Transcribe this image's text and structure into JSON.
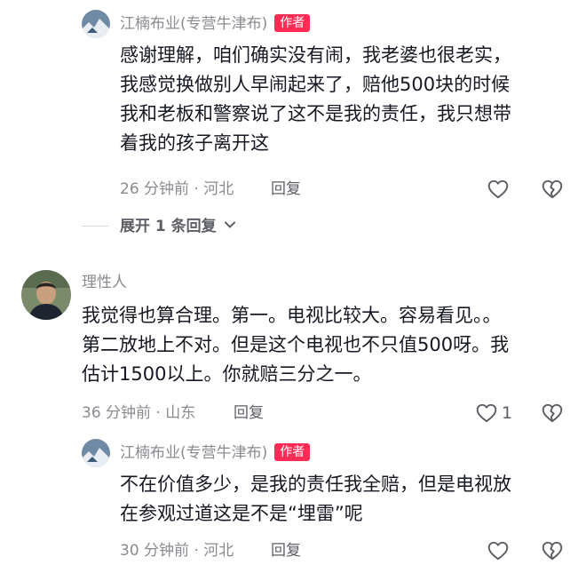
{
  "comments": [
    {
      "username": "江楠布业(专营牛津布)",
      "badge": "作者",
      "lines": [
        "感谢理解，咱们确实没有闹，我老婆也很老实，",
        "我感觉换做别人早闹起来了，赔他500块的时候",
        "我和老板和警察说了这不是我的责任，我只想带",
        "着我的孩子离开这"
      ],
      "meta": "26 分钟前 · 河北",
      "reply_label": "回复",
      "like_count": ""
    },
    {
      "username": "理性人",
      "lines": [
        "我觉得也算合理。第一。电视比较大。容易看见。。",
        "第二放地上不对。但是这个电视也不只值500呀。我",
        "估计1500以上。你就赔三分之一。"
      ],
      "meta": "36 分钟前 · 山东",
      "reply_label": "回复",
      "like_count": "1"
    },
    {
      "username": "江楠布业(专营牛津布)",
      "badge": "作者",
      "lines": [
        "不在价值多少，是我的责任我全赔，但是电视放",
        "在参观过道这是不是“埋雷”呢"
      ],
      "meta": "30 分钟前 · 河北",
      "reply_label": "回复",
      "like_count": ""
    }
  ],
  "expand_replies_label": "展开 1 条回复",
  "icons": {
    "like": "heart-outline-icon",
    "dislike": "broken-heart-icon",
    "expand": "chevron-down-icon"
  },
  "colors": {
    "author_badge": "#fe2c55",
    "meta_gray": "#8a8b91",
    "text": "#161823"
  }
}
